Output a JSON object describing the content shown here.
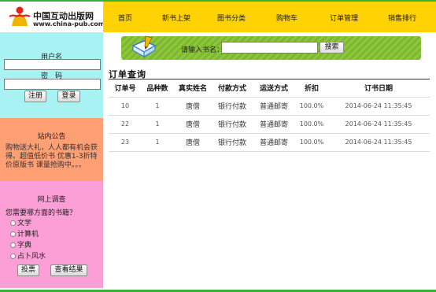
{
  "site": {
    "name_cn": "中国互动出版网",
    "url": "www.china-pub.com"
  },
  "nav": [
    {
      "label": "首页"
    },
    {
      "label": "新书上架"
    },
    {
      "label": "图书分类"
    },
    {
      "label": "购物车"
    },
    {
      "label": "订单管理"
    },
    {
      "label": "销售排行"
    }
  ],
  "login": {
    "username_label": "用户名",
    "password_label": "密　码",
    "register_button": "注册",
    "login_button": "登录"
  },
  "notice": {
    "title": "站内公告",
    "text": "购物送大礼，人人都有机会获得。超值低价书 优惠1-3折特价原版书 课量抢购中。。。"
  },
  "survey": {
    "title": "网上调查",
    "question": "您需要哪方面的书籍？",
    "options": [
      "文学",
      "计算机",
      "字典",
      "占卜风水"
    ],
    "vote_button": "投票",
    "results_button": "查看结果"
  },
  "search": {
    "label": "请输入书名：",
    "value": "",
    "button": "搜索"
  },
  "orders": {
    "title": "订单查询",
    "columns": [
      "订单号",
      "品种数",
      "真实姓名",
      "付款方式",
      "运送方式",
      "折扣",
      "订书日期"
    ],
    "rows": [
      [
        "10",
        "1",
        "唐僧",
        "银行付款",
        "普通邮寄",
        "100.0%",
        "2014-06-24 11:35:45"
      ],
      [
        "22",
        "1",
        "唐僧",
        "银行付款",
        "普通邮寄",
        "100.0%",
        "2014-06-24 11:35:45"
      ],
      [
        "23",
        "1",
        "唐僧",
        "银行付款",
        "普通邮寄",
        "100.0%",
        "2014-06-24 11:35:45"
      ]
    ]
  },
  "colors": {
    "nav_bg": "#ffd203",
    "login_bg": "#a9f2f4",
    "notice_bg": "#fe9f74",
    "survey_bg": "#fc9fd7",
    "searchbar_bg": "#8ec63d",
    "border_green": "#36b336"
  }
}
